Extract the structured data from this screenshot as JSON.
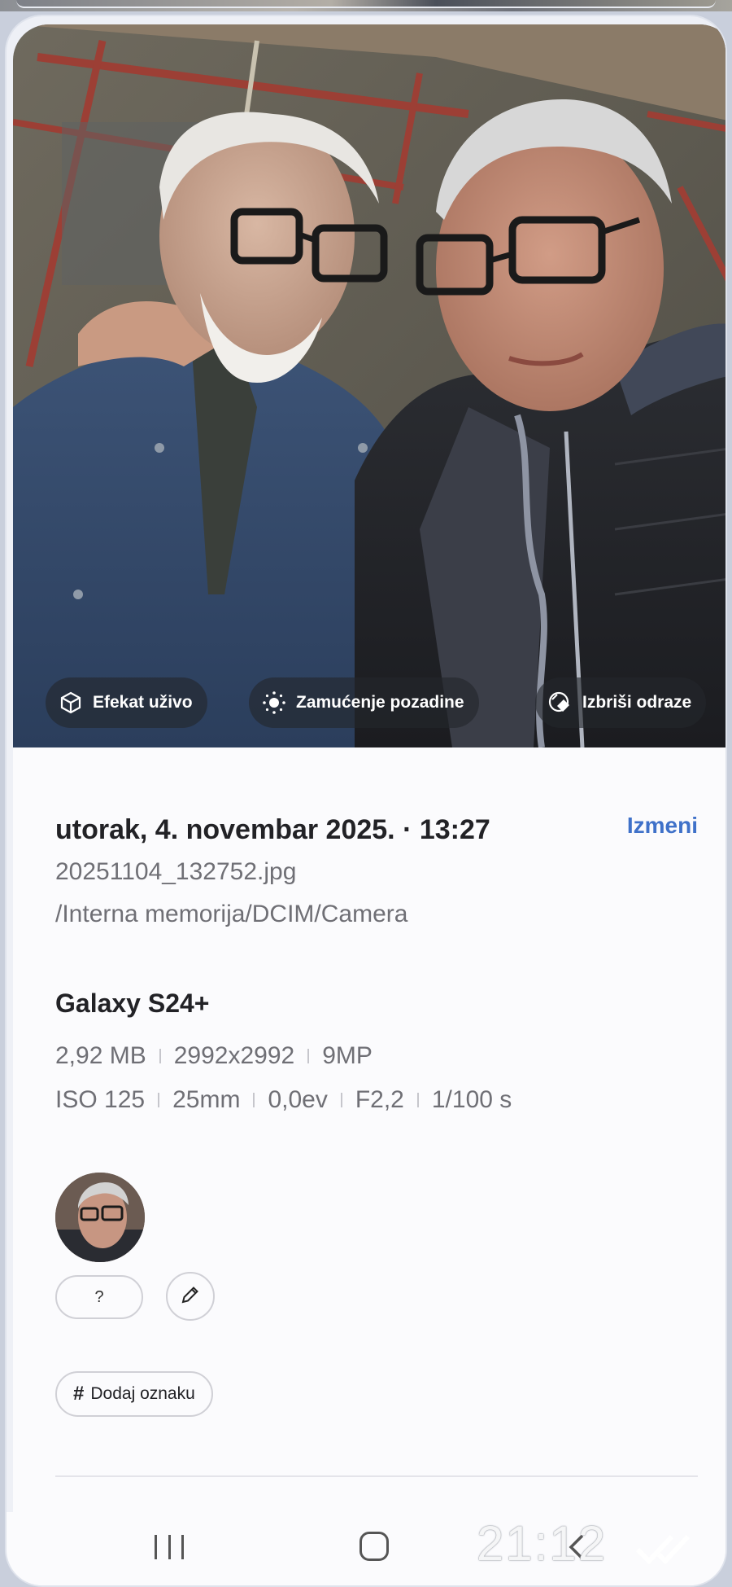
{
  "photo": {
    "actions": [
      {
        "label": "Efekat uživo",
        "icon": "live-effect-icon"
      },
      {
        "label": "Zamućenje pozadine",
        "icon": "background-blur-icon"
      },
      {
        "label": "Izbriši odraze",
        "icon": "erase-reflection-icon"
      }
    ]
  },
  "details": {
    "date_time": "utorak, 4. novembar 2025. · 13:27",
    "edit_label": "Izmeni",
    "filename": "20251104_132752.jpg",
    "path": "/Interna memorija/DCIM/Camera",
    "device": "Galaxy S24+",
    "file_specs": [
      "2,92 MB",
      "2992x2992",
      "9MP"
    ],
    "camera_specs": [
      "ISO 125",
      "25mm",
      "0,0ev",
      "F2,2",
      "1/100 s"
    ]
  },
  "people": {
    "unknown_label": "?",
    "edit_icon": "pencil-icon"
  },
  "tags": {
    "add_tag_label": "Dodaj oznaku"
  },
  "overlay": {
    "clock": "21:12"
  },
  "colors": {
    "accent": "#3f71c9",
    "chip_bg": "#23262c",
    "sheet_bg": "#fbfbfd"
  }
}
